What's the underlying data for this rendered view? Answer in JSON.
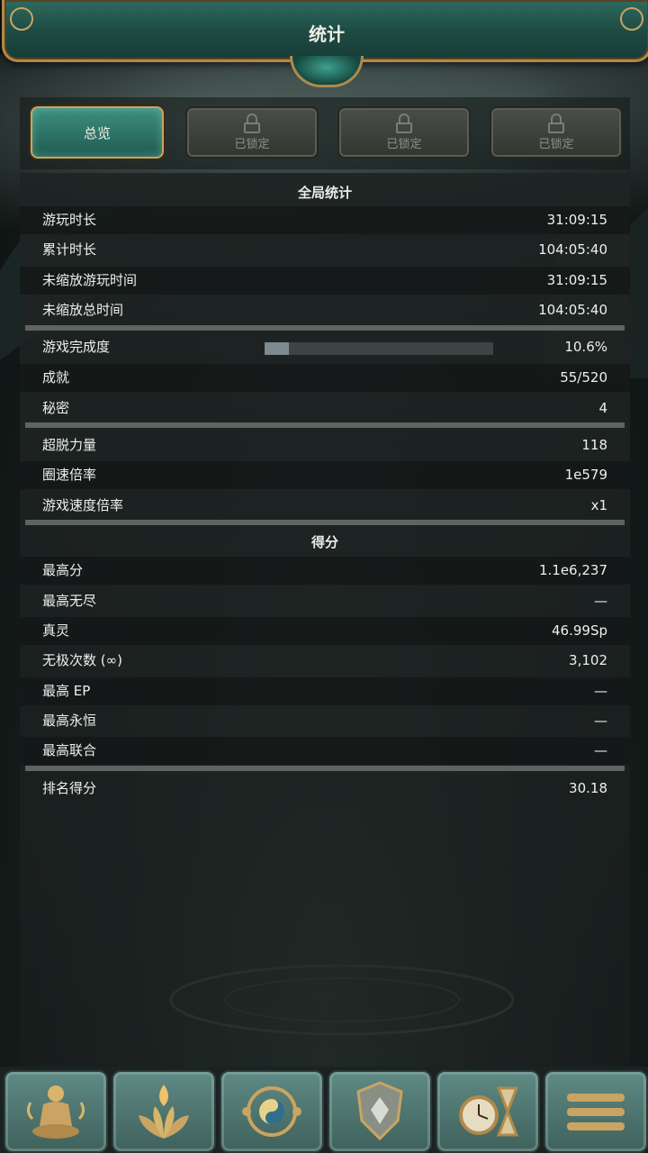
{
  "header": {
    "title": "统计"
  },
  "tabs": [
    {
      "label": "总览",
      "active": true
    },
    {
      "label": "已锁定",
      "locked": true,
      "icon": "lock-icon"
    },
    {
      "label": "已锁定",
      "locked": true,
      "icon": "lock-icon"
    },
    {
      "label": "已锁定",
      "locked": true,
      "icon": "lock-icon"
    }
  ],
  "global_stats": {
    "title": "全局统计",
    "time": [
      {
        "label": "游玩时长",
        "value": "31:09:15"
      },
      {
        "label": "累计时长",
        "value": "104:05:40"
      },
      {
        "label": "未缩放游玩时间",
        "value": "31:09:15"
      },
      {
        "label": "未缩放总时间",
        "value": "104:05:40"
      }
    ],
    "completion": {
      "label": "游戏完成度",
      "value": "10.6%",
      "progress": 0.106
    },
    "progress_items": [
      {
        "label": "成就",
        "value": "55/520"
      },
      {
        "label": "秘密",
        "value": "4"
      }
    ],
    "power": [
      {
        "label": "超脱力量",
        "value": "118"
      },
      {
        "label": "圈速倍率",
        "value": "1e579"
      },
      {
        "label": "游戏速度倍率",
        "value": "x1"
      }
    ]
  },
  "score": {
    "title": "得分",
    "items": [
      {
        "label": "最高分",
        "value": "1.1e6,237"
      },
      {
        "label": "最高无尽",
        "value": "—"
      },
      {
        "label": "真灵",
        "value": "46.99Sp"
      },
      {
        "label": "无极次数 (∞)",
        "value": "3,102"
      },
      {
        "label": "最高 EP",
        "value": "—"
      },
      {
        "label": "最高永恒",
        "value": "—"
      },
      {
        "label": "最高联合",
        "value": "—"
      }
    ],
    "rank": {
      "label": "排名得分",
      "value": "30.18"
    }
  },
  "bottom_nav": [
    {
      "icon": "meditating-buddha-icon"
    },
    {
      "icon": "flaming-lotus-icon"
    },
    {
      "icon": "taiji-compass-icon"
    },
    {
      "icon": "crest-shield-icon"
    },
    {
      "icon": "pocketwatch-hourglass-icon"
    },
    {
      "icon": "menu-bars-icon"
    }
  ],
  "colors": {
    "accent": "#2f7a6c",
    "gold": "#c9a462",
    "panel": "#1e2423"
  }
}
